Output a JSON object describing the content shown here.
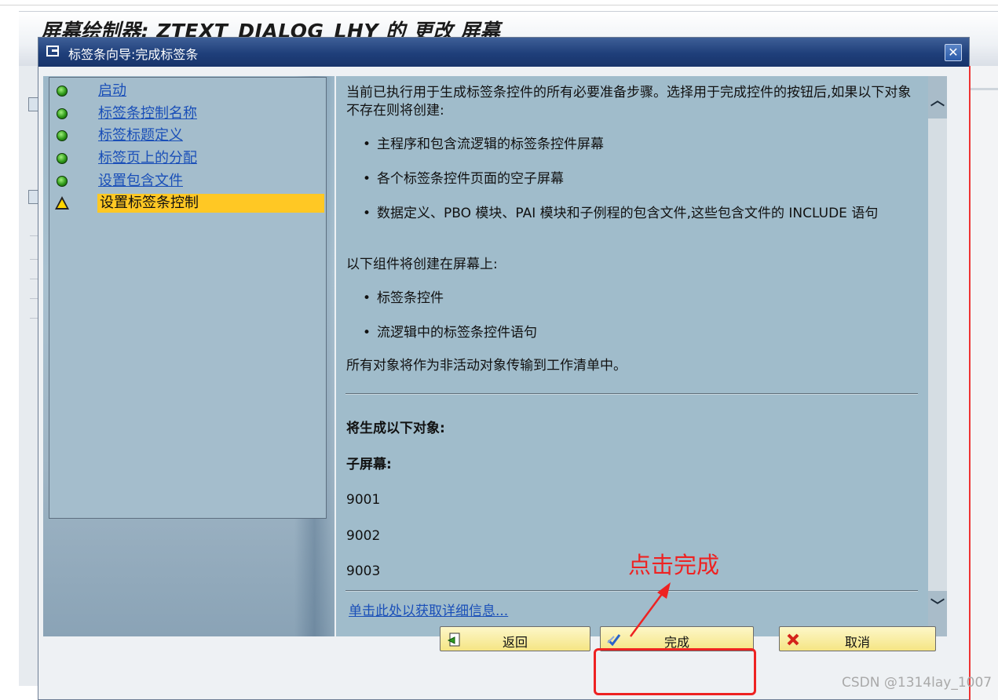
{
  "background": {
    "title": "屏幕绘制器: ZTEXT_DIALOG_LHY 的 更改 屏幕"
  },
  "dialog": {
    "title": "标签条向导:完成标签条",
    "close_symbol": "✕"
  },
  "nav": {
    "items": [
      {
        "label": "启动",
        "status": "done"
      },
      {
        "label": "标签条控制名称",
        "status": "done"
      },
      {
        "label": "标签标题定义",
        "status": "done"
      },
      {
        "label": "标签页上的分配",
        "status": "done"
      },
      {
        "label": "设置包含文件",
        "status": "done"
      },
      {
        "label": "设置标签条控制",
        "status": "current"
      }
    ]
  },
  "content": {
    "intro": "当前已执行用于生成标签条控件的所有必要准备步骤。选择用于完成控件的按钮后,如果以下对象不存在则将创建:",
    "bullets_create": [
      "主程序和包含流逻辑的标签条控件屏幕",
      "各个标签条控件页面的空子屏幕",
      "数据定义、PBO 模块、PAI 模块和子例程的包含文件,这些包含文件的 INCLUDE 语句"
    ],
    "screen_components_heading": "以下组件将创建在屏幕上:",
    "bullets_screen": [
      "标签条控件",
      "流逻辑中的标签条控件语句"
    ],
    "transport_note": "所有对象将作为非活动对象传输到工作清单中。",
    "generated_heading": "将生成以下对象:",
    "subscreen_heading": "子屏幕:",
    "subscreens": [
      "9001",
      "9002",
      "9003"
    ],
    "more_info_link": "单击此处以获取详细信息..."
  },
  "buttons": {
    "back": "返回",
    "finish": "完成",
    "cancel": "取消"
  },
  "annotation": {
    "label": "点击完成"
  },
  "watermark": "CSDN @1314lay_1007",
  "colors": {
    "title_bar": "#1f3f7a",
    "active_step": "#ffc824",
    "link": "#1a4fb8",
    "annotation": "#ee2222",
    "button": "#f5e584"
  }
}
